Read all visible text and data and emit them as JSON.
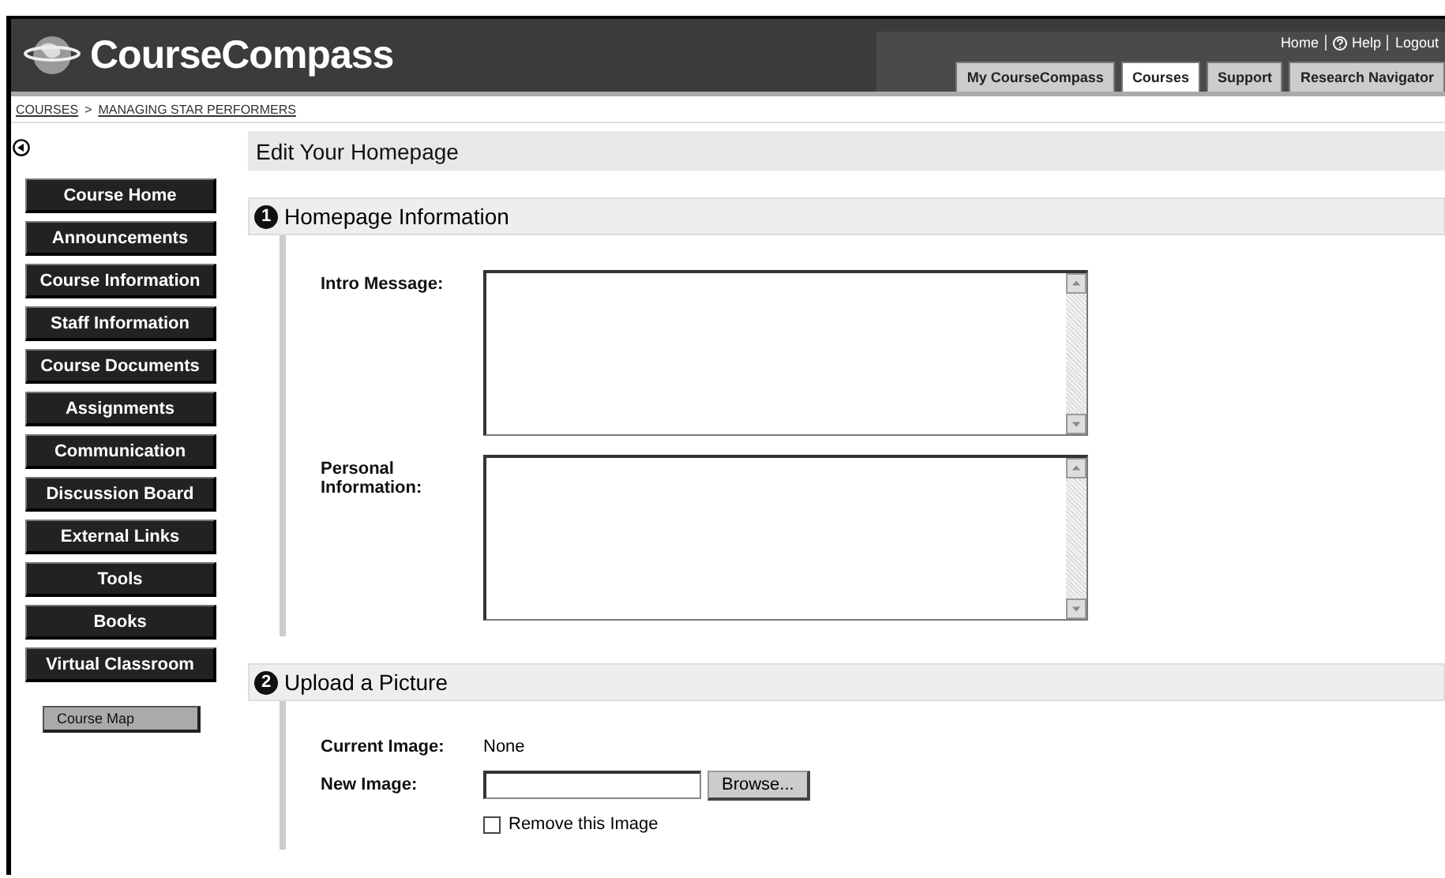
{
  "header": {
    "logo": "CourseCompass",
    "links": [
      "Home",
      "Help",
      "Logout"
    ],
    "tabs": [
      {
        "label": "My CourseCompass",
        "selected": false
      },
      {
        "label": "Courses",
        "selected": true
      },
      {
        "label": "Support",
        "selected": false
      },
      {
        "label": "Research Navigator",
        "selected": false
      }
    ]
  },
  "breadcrumb": {
    "items": [
      "COURSES",
      "MANAGING STAR PERFORMERS"
    ],
    "separator": ">"
  },
  "page_title": "Edit Your Homepage",
  "sidebar": {
    "items": [
      "Course Home",
      "Announcements",
      "Course Information",
      "Staff Information",
      "Course Documents",
      "Assignments",
      "Communication",
      "Discussion Board",
      "External Links",
      "Tools",
      "Books",
      "Virtual Classroom"
    ],
    "course_map": "Course Map"
  },
  "sections": [
    {
      "number": "1",
      "title": "Homepage Information",
      "fields": [
        {
          "kind": "textarea",
          "label": "Intro Message:"
        },
        {
          "kind": "textarea",
          "label": "Personal Information:"
        }
      ]
    },
    {
      "number": "2",
      "title": "Upload a Picture",
      "fields": [
        {
          "kind": "text",
          "label": "Current Image:",
          "value": "None"
        },
        {
          "kind": "file",
          "label": "New Image:",
          "button": "Browse..."
        },
        {
          "kind": "checkbox",
          "label": "Remove this Image",
          "checked": false
        }
      ]
    }
  ]
}
